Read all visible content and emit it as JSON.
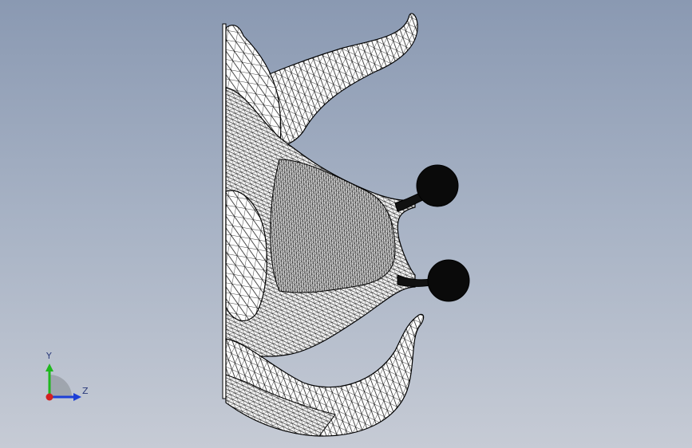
{
  "viewport": {
    "background_top": "#8a99b2",
    "background_bottom": "#c6cbd5",
    "mesh_color": "#000000",
    "surface_color": "#ffffff"
  },
  "triad": {
    "y_label": "Y",
    "z_label": "Z",
    "y_color": "#1fb81f",
    "z_color": "#1c3fd6",
    "x_color": "#d42020"
  }
}
